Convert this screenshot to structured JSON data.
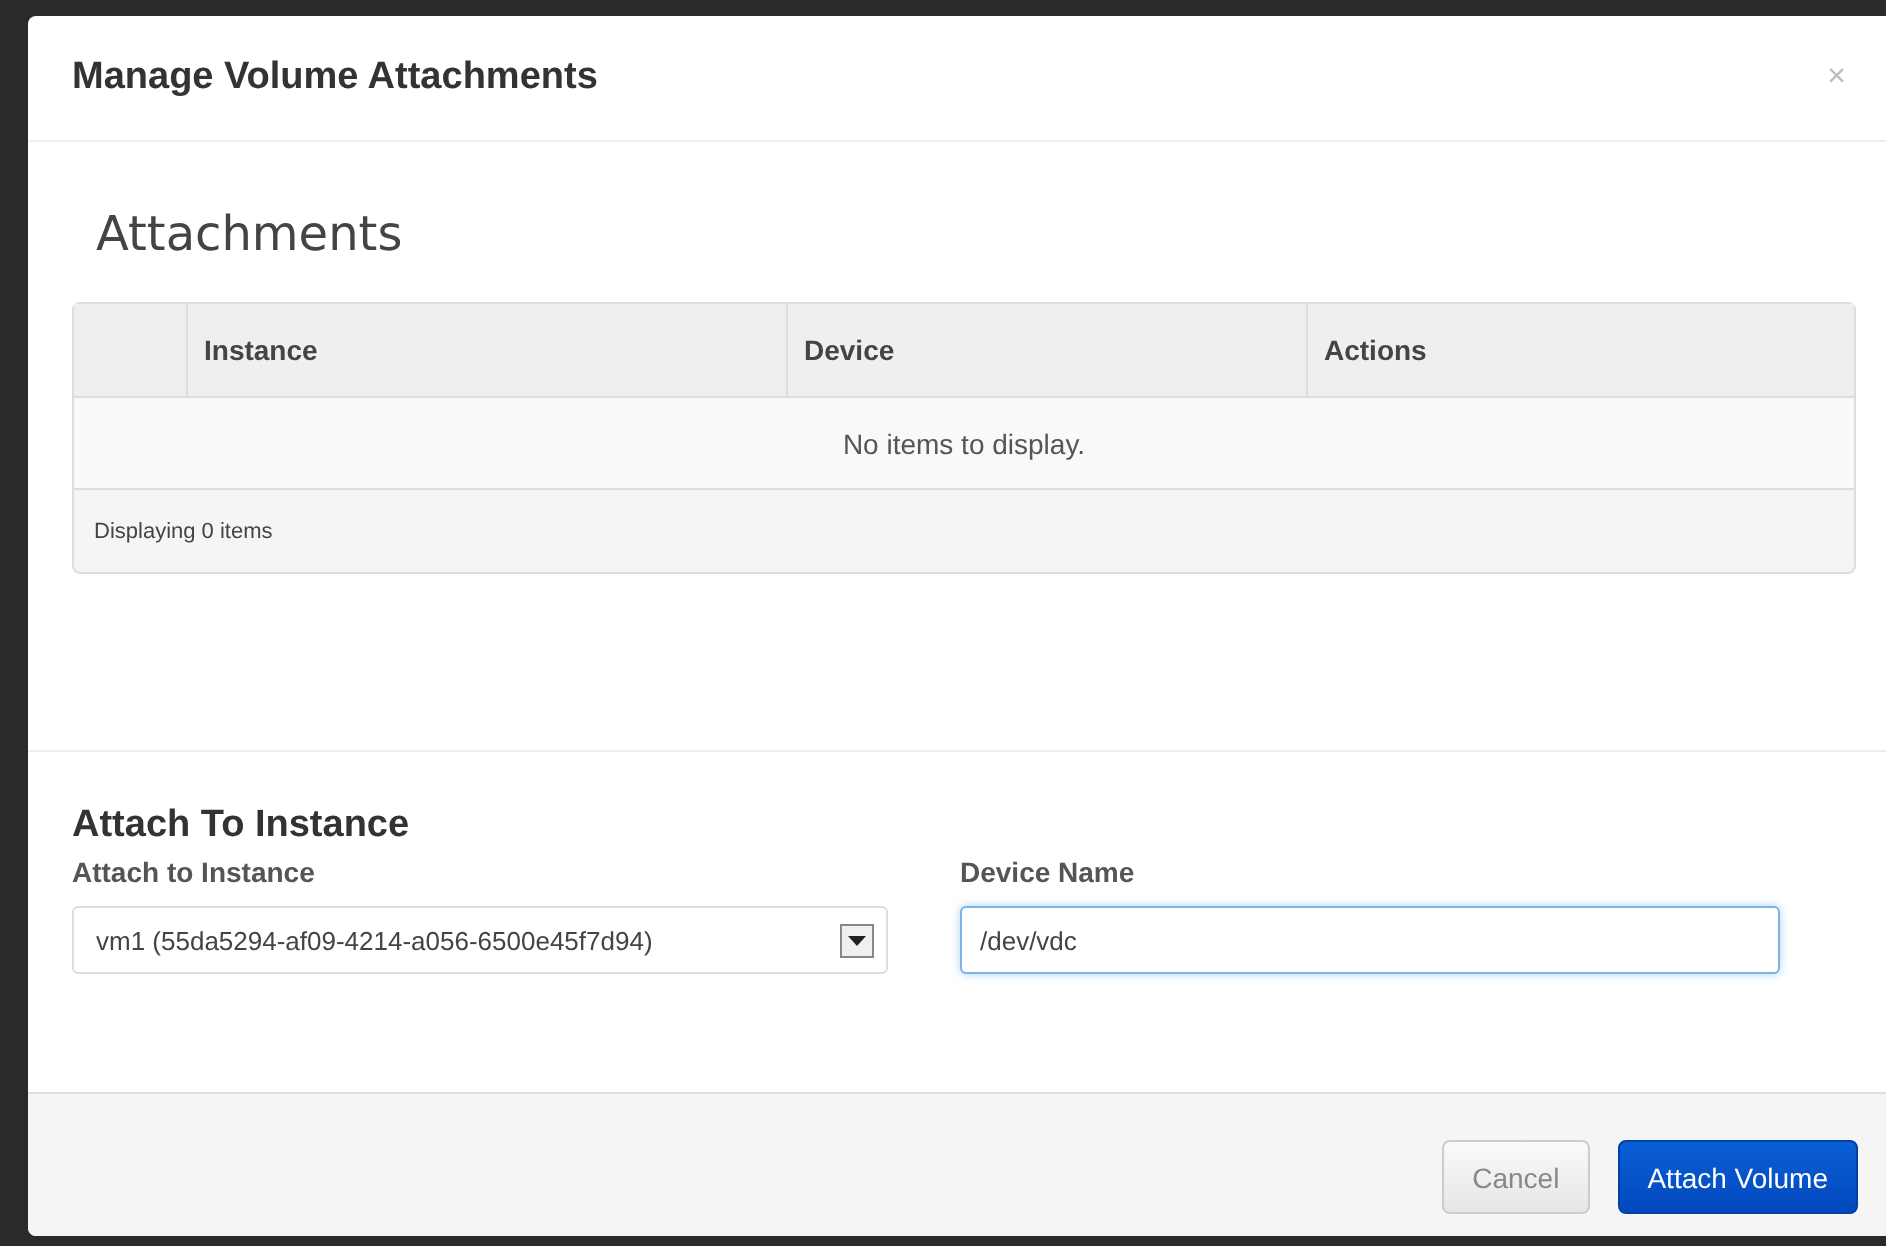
{
  "modal": {
    "title": "Manage Volume Attachments",
    "close": "×"
  },
  "attachments": {
    "heading": "Attachments",
    "columns": [
      "Instance",
      "Device",
      "Actions"
    ],
    "empty_message": "No items to display.",
    "footer": "Displaying 0 items"
  },
  "attach_form": {
    "heading": "Attach To Instance",
    "instance_label": "Attach to Instance",
    "instance_value": "vm1 (55da5294-af09-4214-a056-6500e45f7d94)",
    "device_label": "Device Name",
    "device_value": "/dev/vdc"
  },
  "buttons": [
    {
      "label": "Cancel",
      "kind": "secondary"
    },
    {
      "label": "Attach Volume",
      "kind": "primary"
    }
  ]
}
